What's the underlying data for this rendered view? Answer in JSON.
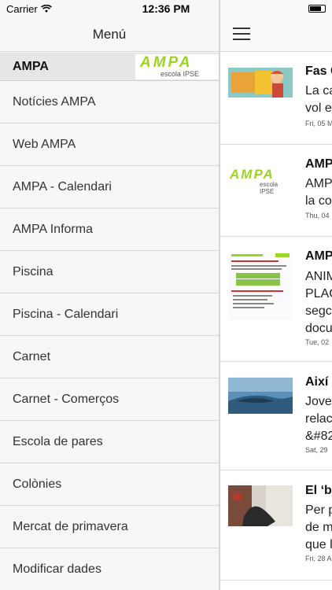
{
  "status_bar": {
    "carrier": "Carrier",
    "time": "12:36 PM"
  },
  "menu": {
    "title": "Menú",
    "section_label": "AMPA",
    "logo_text": "AMPA",
    "logo_subtext": "escola IPSE",
    "items": [
      {
        "label": "Notícies AMPA"
      },
      {
        "label": "Web AMPA"
      },
      {
        "label": "AMPA - Calendari"
      },
      {
        "label": "AMPA Informa"
      },
      {
        "label": "Piscina"
      },
      {
        "label": "Piscina - Calendari"
      },
      {
        "label": "Carnet"
      },
      {
        "label": "Carnet - Comerços"
      },
      {
        "label": "Escola de pares"
      },
      {
        "label": "Colònies"
      },
      {
        "label": "Mercat de primavera"
      },
      {
        "label": "Modificar dades"
      }
    ]
  },
  "news": {
    "items": [
      {
        "title": "Fas C",
        "body": [
          "La ca",
          "vol e"
        ],
        "date": "Fri, 05 M"
      },
      {
        "title": "AMPA",
        "body": [
          "AMP",
          "la co"
        ],
        "date": "Thu, 04"
      },
      {
        "title": "AMP",
        "body": [
          "ANIM",
          "PLAC",
          "segc",
          "docu"
        ],
        "date": "Tue, 02"
      },
      {
        "title": "Així",
        "body": [
          "Jove",
          "relac",
          "&#82"
        ],
        "date": "Sat, 29"
      },
      {
        "title": "El ‘b",
        "body": [
          "Per p",
          "de m",
          "que l"
        ],
        "date": "Fri, 28 A"
      }
    ]
  },
  "colors": {
    "accent_green": "#9bd422",
    "menu_bg": "#f7f7f7",
    "section_bg": "#e6e6e6"
  }
}
